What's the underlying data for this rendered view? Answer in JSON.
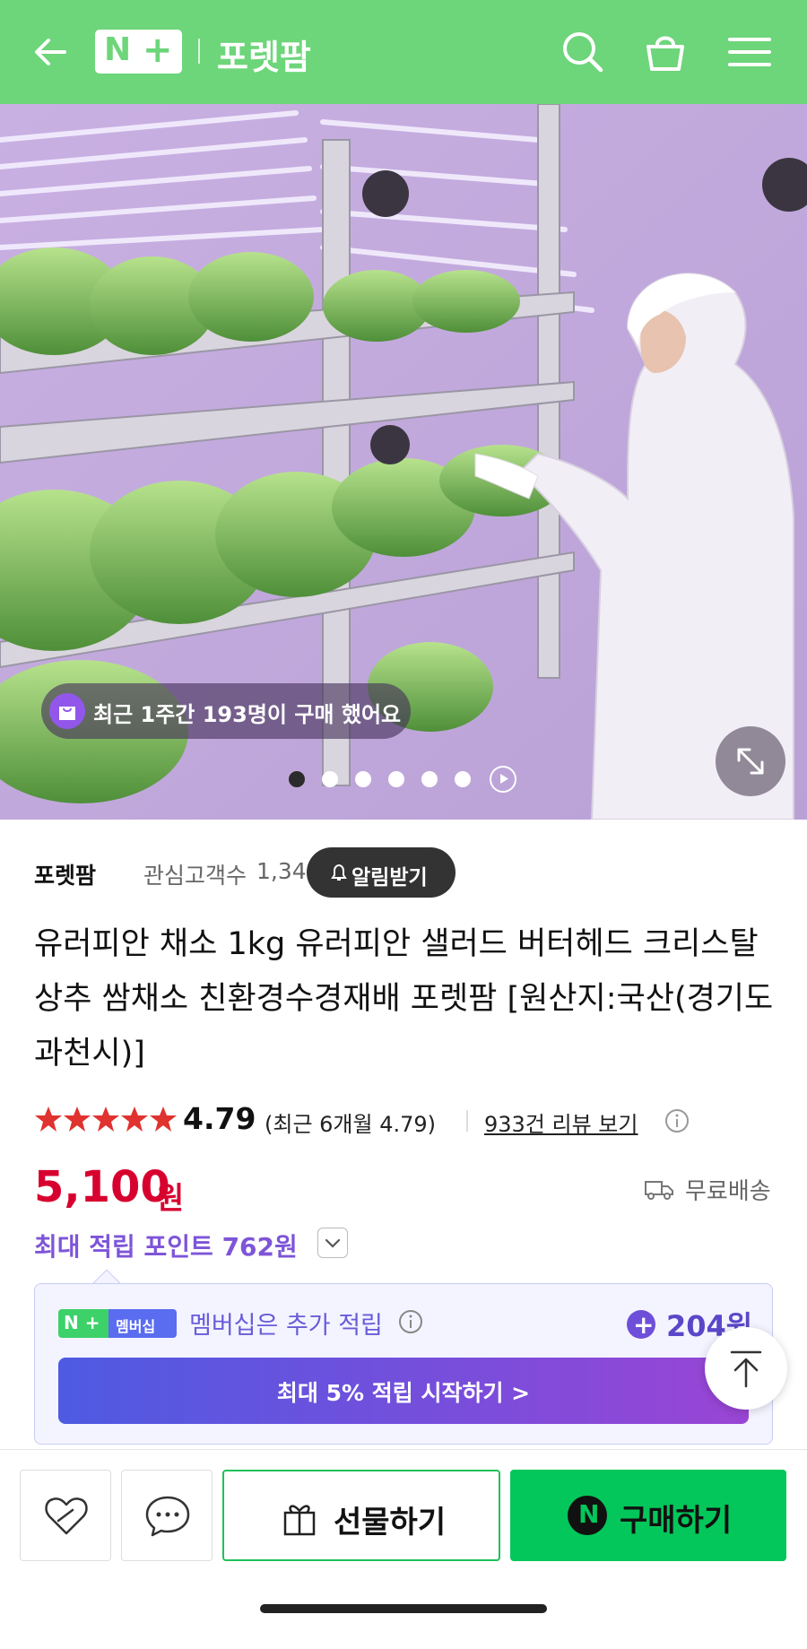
{
  "header": {
    "logo_n": "N",
    "logo_plus": "+",
    "store_name": "포렛팜",
    "icons": [
      "back-arrow-icon",
      "search-icon",
      "shopping-bag-icon",
      "hamburger-menu-icon"
    ],
    "bg_color": "#6dd57a"
  },
  "hero": {
    "buyers_notice": "최근 1주간 193명이 구매 했어요",
    "slide_count": 6,
    "active_slide": 1,
    "icons": [
      "purchase-bag-icon",
      "play-icon",
      "expand-icon"
    ]
  },
  "seller": {
    "name": "포렛팜",
    "followers_label": "관심고객수",
    "followers_count": "1,340",
    "notify_label": "알림받기"
  },
  "product": {
    "title": "유러피안 채소 1kg 유러피안 샐러드 버터헤드 크리스탈 상추 쌈채소 친환경수경재배 포렛팜 [원산지:국산(경기도 과천시)]",
    "rating": "4.79",
    "rating_recent": "(최근 6개월 4.79)",
    "review_link": "933건 리뷰 보기",
    "star_count": 5,
    "price": "5,100",
    "currency": "원",
    "delivery": "무료배송",
    "points_text": "최대 적립 포인트 762원",
    "price_color": "#d7002f",
    "points_color": "#7e55d8"
  },
  "membership": {
    "badge_left": "N +",
    "badge_right": "멤버십",
    "message": "멤버십은 추가 적립",
    "extra_points": "204원",
    "cta": "최대 5% 적립 시작하기 >"
  },
  "bottom": {
    "gift_label": "선물하기",
    "buy_label": "구매하기",
    "buy_logo": "N",
    "icons": [
      "heart-like-icon",
      "chat-bubble-icon",
      "gift-icon"
    ],
    "buy_color": "#03c75a"
  }
}
